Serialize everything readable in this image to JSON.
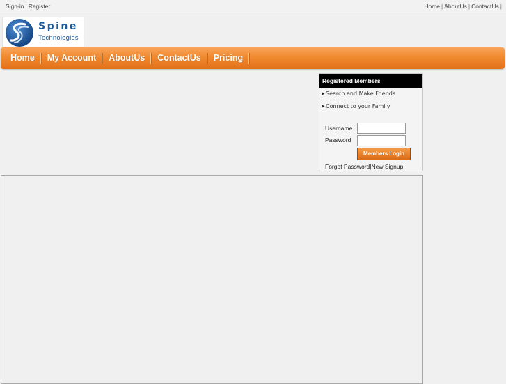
{
  "topbar": {
    "left_links": [
      "Sign-in",
      "Register"
    ],
    "right_links": [
      "Home",
      "AboutUs",
      "ContactUs"
    ]
  },
  "logo": {
    "brand": "Spine",
    "subtitle": "Technologies"
  },
  "nav": {
    "items": [
      "Home",
      "My Account",
      "AboutUs",
      "ContactUs",
      "Pricing"
    ]
  },
  "login_panel": {
    "title": "Registered Members",
    "features": [
      "Search and Make Friends",
      "Connect to your Family"
    ],
    "username_label": "Username",
    "password_label": "Password",
    "username_value": "",
    "password_value": "",
    "login_button": "Members Login",
    "forgot_link": "Forgot Password",
    "signup_link": "New Signup",
    "link_separator": "|"
  },
  "colors": {
    "nav_orange": "#f08a2f",
    "brand_blue": "#1c5a9e",
    "panel_header": "#000000"
  }
}
